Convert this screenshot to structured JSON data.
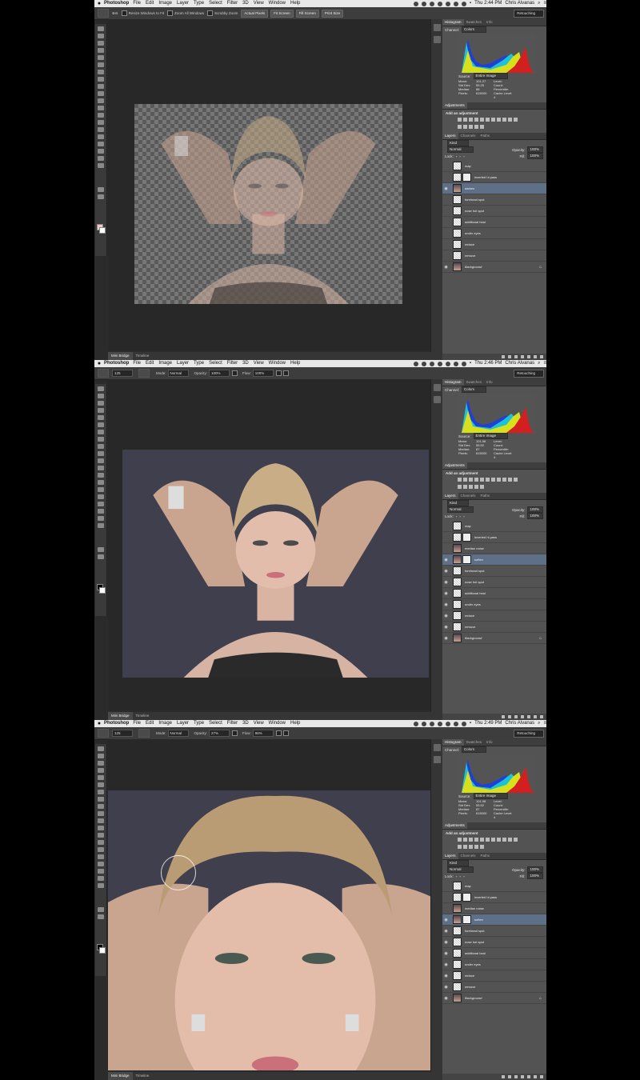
{
  "menu": {
    "app": "Photoshop",
    "items": [
      "File",
      "Edit",
      "Image",
      "Layer",
      "Type",
      "Select",
      "Filter",
      "3D",
      "View",
      "Window",
      "Help"
    ],
    "user": "Chris Alvanas"
  },
  "shots": [
    {
      "time": "Thu 2:44 PM",
      "options": {
        "checks": [
          "Resize Windows to Fit",
          "Zoom All Windows",
          "Scrubby Zoom"
        ],
        "buttons": [
          "Actual Pixels",
          "Fit Screen",
          "Fill Screen",
          "Print Size"
        ]
      },
      "preset": "Retouching",
      "layers": [
        {
          "name": "map",
          "eye": false,
          "thumb": "check",
          "selected": false
        },
        {
          "name": "inverted hi pass",
          "eye": false,
          "thumb": "check",
          "mask": true,
          "selected": false
        },
        {
          "name": "darken",
          "eye": true,
          "thumb": "photo",
          "selected": true
        },
        {
          "name": "forehead spot",
          "eye": false,
          "thumb": "check",
          "selected": false
        },
        {
          "name": "nose hot spot",
          "eye": false,
          "thumb": "check",
          "selected": false
        },
        {
          "name": "additional heal",
          "eye": false,
          "thumb": "check",
          "selected": false
        },
        {
          "name": "under eyes",
          "eye": false,
          "thumb": "check",
          "selected": false
        },
        {
          "name": "reduce",
          "eye": false,
          "thumb": "check",
          "selected": false
        },
        {
          "name": "remove",
          "eye": false,
          "thumb": "check",
          "selected": false
        },
        {
          "name": "Background",
          "eye": true,
          "thumb": "photo",
          "selected": false,
          "italic": true,
          "locked": true
        }
      ],
      "stats": {
        "mean": "101.27",
        "std_dev": "55.25",
        "median": "88",
        "pixels": "615000"
      },
      "blend_mode": "Normal",
      "opacity": "100%",
      "fill": "100%"
    },
    {
      "time": "Thu 2:46 PM",
      "options": {
        "brush_size": "125",
        "mode": "Normal",
        "opacity": "100%",
        "flow": "100%"
      },
      "preset": "Retouching",
      "layers": [
        {
          "name": "map",
          "eye": false,
          "thumb": "check",
          "selected": false
        },
        {
          "name": "inverted hi pass",
          "eye": false,
          "thumb": "check",
          "mask": true,
          "selected": false
        },
        {
          "name": "median noise",
          "eye": false,
          "thumb": "photo",
          "selected": false
        },
        {
          "name": "soften",
          "eye": true,
          "thumb": "photo",
          "mask": true,
          "selected": true
        },
        {
          "name": "forehead spot",
          "eye": true,
          "thumb": "check",
          "selected": false
        },
        {
          "name": "nose hot spot",
          "eye": true,
          "thumb": "check",
          "selected": false
        },
        {
          "name": "additional heal",
          "eye": true,
          "thumb": "check",
          "selected": false
        },
        {
          "name": "under eyes",
          "eye": true,
          "thumb": "check",
          "selected": false
        },
        {
          "name": "reduce",
          "eye": true,
          "thumb": "check",
          "selected": false
        },
        {
          "name": "remove",
          "eye": true,
          "thumb": "check",
          "selected": false
        },
        {
          "name": "Background",
          "eye": true,
          "thumb": "photo",
          "selected": false,
          "italic": true,
          "locked": true
        }
      ],
      "stats": {
        "mean": "101.06",
        "std_dev": "55.52",
        "median": "87",
        "pixels": "615000"
      },
      "blend_mode": "Normal",
      "opacity": "100%",
      "fill": "100%"
    },
    {
      "time": "Thu 2:49 PM",
      "options": {
        "brush_size": "125",
        "mode": "Normal",
        "opacity": "27%",
        "flow": "96%"
      },
      "preset": "Retouching",
      "layers": [
        {
          "name": "map",
          "eye": false,
          "thumb": "check",
          "selected": false
        },
        {
          "name": "inverted hi pass",
          "eye": false,
          "thumb": "check",
          "mask": true,
          "selected": false
        },
        {
          "name": "median noise",
          "eye": false,
          "thumb": "photo",
          "selected": false
        },
        {
          "name": "soften",
          "eye": true,
          "thumb": "photo",
          "mask": true,
          "selected": true
        },
        {
          "name": "forehead spot",
          "eye": true,
          "thumb": "check",
          "selected": false
        },
        {
          "name": "nose hot spot",
          "eye": true,
          "thumb": "check",
          "selected": false
        },
        {
          "name": "additional heal",
          "eye": true,
          "thumb": "check",
          "selected": false
        },
        {
          "name": "under eyes",
          "eye": true,
          "thumb": "check",
          "selected": false
        },
        {
          "name": "reduce",
          "eye": true,
          "thumb": "check",
          "selected": false
        },
        {
          "name": "remove",
          "eye": true,
          "thumb": "check",
          "selected": false
        },
        {
          "name": "Background",
          "eye": true,
          "thumb": "photo",
          "selected": false,
          "italic": true,
          "locked": true
        }
      ],
      "stats": {
        "mean": "101.08",
        "std_dev": "55.52",
        "median": "87",
        "pixels": "615000"
      },
      "blend_mode": "Normal",
      "opacity": "100%",
      "fill": "100%"
    }
  ],
  "labels": {
    "mode": "Mode:",
    "opacity": "Opacity:",
    "flow": "Flow:",
    "histogram_tabs": [
      "Histogram",
      "Swatches",
      "Info"
    ],
    "channel": "Channel:",
    "channel_value": "Colors",
    "source": "Source:",
    "source_value": "Entire Image",
    "stat_labels": [
      "Mean:",
      "Std Dev:",
      "Median:",
      "Pixels:"
    ],
    "stat_right": [
      "Level:",
      "Count:",
      "Percentile:",
      "Cache Level: 4"
    ],
    "adjustments_tab": "Adjustments",
    "add_adjustment": "Add an adjustment",
    "layer_tabs": [
      "Layers",
      "Channels",
      "Paths"
    ],
    "kind": "Kind",
    "lock": "Lock:",
    "fill": "Fill:",
    "bottom_tabs": [
      "Mini Bridge",
      "Timeline"
    ]
  },
  "colors": {
    "selected_layer": "#5e6f88",
    "panel": "#535353",
    "workspace": "#2b2b2b"
  }
}
